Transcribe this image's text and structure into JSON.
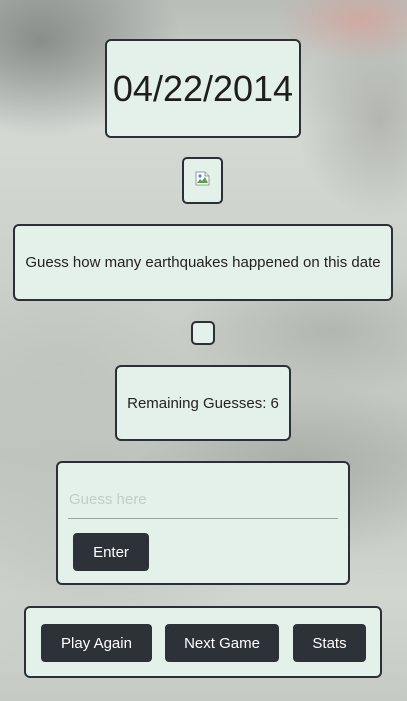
{
  "game": {
    "date": "04/22/2014",
    "prompt": "Guess how many earthquakes happened on this date",
    "remaining_guesses": "Remaining Guesses: 6"
  },
  "image": {
    "state": "broken",
    "icon": "broken-image-icon"
  },
  "guess": {
    "placeholder": "Guess here",
    "value": "",
    "enter_label": "Enter"
  },
  "actions": {
    "play_again_label": "Play Again",
    "next_game_label": "Next Game",
    "stats_label": "Stats"
  },
  "colors": {
    "card_background": "#e3f1ea",
    "card_border": "#2c3035",
    "button_background": "#2d3238",
    "button_text": "#ffffff"
  }
}
